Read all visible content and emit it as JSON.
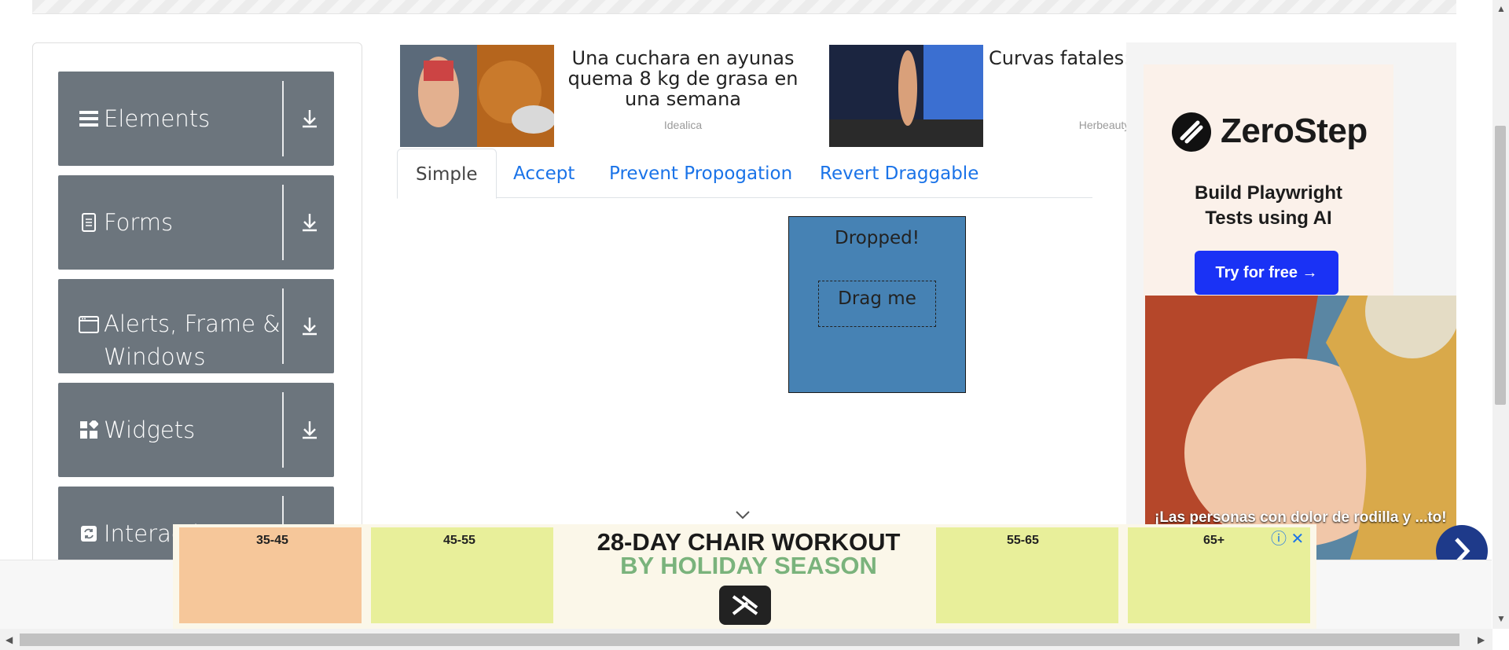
{
  "sidebar": {
    "groups": [
      {
        "label": "Elements",
        "icon": "menu-icon"
      },
      {
        "label": "Forms",
        "icon": "document-icon"
      },
      {
        "label": "Alerts, Frame & Windows",
        "icon": "window-icon"
      },
      {
        "label": "Widgets",
        "icon": "widgets-icon"
      },
      {
        "label": "Interactions",
        "icon": "interactions-icon"
      }
    ]
  },
  "ads": [
    {
      "title": "Una cuchara en ayunas quema 8 kg de grasa en una semana",
      "source": "Idealica"
    },
    {
      "title": "Curvas fatales: esta modelo fue ... por el F...",
      "source": "Herbeauty"
    }
  ],
  "tabs": [
    {
      "label": "Simple",
      "active": true
    },
    {
      "label": "Accept",
      "active": false
    },
    {
      "label": "Prevent Propogation",
      "active": false
    },
    {
      "label": "Revert Draggable",
      "active": false
    }
  ],
  "droppable": {
    "text": "Dropped!",
    "color": "#4682b4"
  },
  "draggable": {
    "text": "Drag me"
  },
  "right_ad": {
    "brand": "ZeroStep",
    "tagline": "Build Playwright Tests using AI",
    "cta": "Try for free →",
    "caption": "¡Las personas con dolor de rodilla y ...to!"
  },
  "bottom_ad": {
    "title": "28-DAY CHAIR WORKOUT",
    "subtitle": "BY HOLIDAY SEASON",
    "ages": [
      "35-45",
      "45-55",
      "55-65",
      "65+"
    ]
  },
  "colors": {
    "sidebar_group": "#6c757d",
    "tab_link": "#1a73e8",
    "cta": "#1a32f5"
  }
}
